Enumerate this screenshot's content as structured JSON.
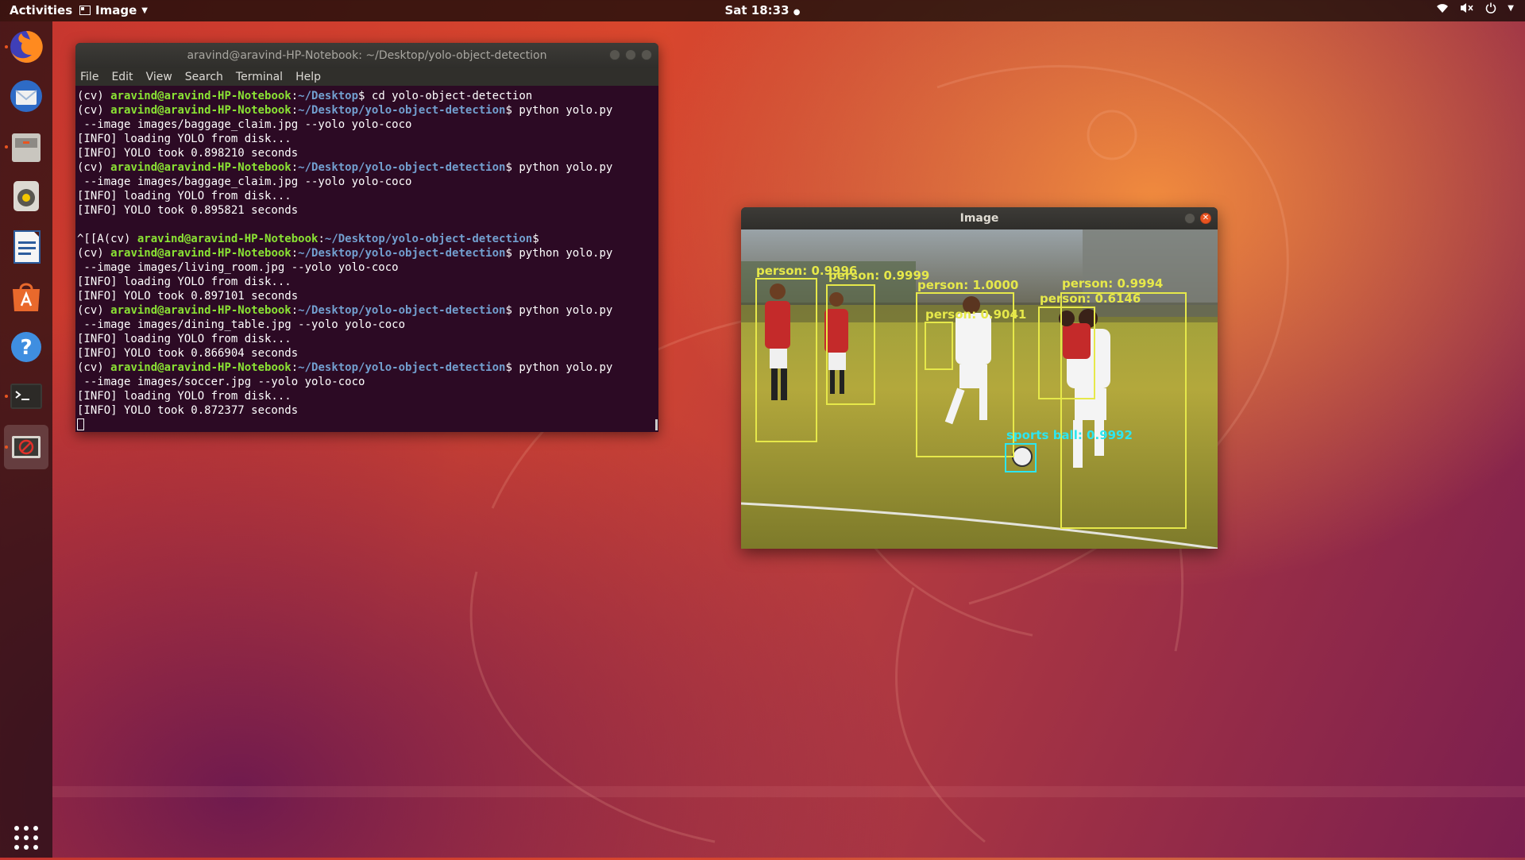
{
  "topbar": {
    "activities": "Activities",
    "app_name": "Image",
    "clock": "Sat 18:33"
  },
  "dock": {
    "items": [
      {
        "name": "firefox",
        "icon": "firefox-icon"
      },
      {
        "name": "thunderbird",
        "icon": "mail-icon"
      },
      {
        "name": "files",
        "icon": "files-icon"
      },
      {
        "name": "rhythmbox",
        "icon": "music-icon"
      },
      {
        "name": "libreoffice-writer",
        "icon": "writer-icon"
      },
      {
        "name": "ubuntu-software",
        "icon": "software-icon"
      },
      {
        "name": "help",
        "icon": "help-icon"
      },
      {
        "name": "terminal",
        "icon": "terminal-icon"
      },
      {
        "name": "image-viewer",
        "icon": "image-icon"
      }
    ],
    "show_apps_icon": "grid-icon"
  },
  "terminal": {
    "title": "aravind@aravind-HP-Notebook: ~/Desktop/yolo-object-detection",
    "menu": [
      "File",
      "Edit",
      "View",
      "Search",
      "Terminal",
      "Help"
    ],
    "env": "(cv) ",
    "user": "aravind@aravind-HP-Notebook",
    "lines": [
      {
        "prompt": true,
        "path": "~/Desktop",
        "cmd": "$ cd yolo-object-detection"
      },
      {
        "prompt": true,
        "path": "~/Desktop/yolo-object-detection",
        "cmd": "$ python yolo.py"
      },
      {
        "text": " --image images/baggage_claim.jpg --yolo yolo-coco"
      },
      {
        "text": "[INFO] loading YOLO from disk..."
      },
      {
        "text": "[INFO] YOLO took 0.898210 seconds"
      },
      {
        "prompt": true,
        "path": "~/Desktop/yolo-object-detection",
        "cmd": "$ python yolo.py"
      },
      {
        "text": " --image images/baggage_claim.jpg --yolo yolo-coco"
      },
      {
        "text": "[INFO] loading YOLO from disk..."
      },
      {
        "text": "[INFO] YOLO took 0.895821 seconds"
      },
      {
        "text": ""
      },
      {
        "prompt": true,
        "prefix": "^[[A",
        "path": "~/Desktop/yolo-object-detection",
        "cmd": "$"
      },
      {
        "prompt": true,
        "path": "~/Desktop/yolo-object-detection",
        "cmd": "$ python yolo.py"
      },
      {
        "text": " --image images/living_room.jpg --yolo yolo-coco"
      },
      {
        "text": "[INFO] loading YOLO from disk..."
      },
      {
        "text": "[INFO] YOLO took 0.897101 seconds"
      },
      {
        "prompt": true,
        "path": "~/Desktop/yolo-object-detection",
        "cmd": "$ python yolo.py"
      },
      {
        "text": " --image images/dining_table.jpg --yolo yolo-coco"
      },
      {
        "text": "[INFO] loading YOLO from disk..."
      },
      {
        "text": "[INFO] YOLO took 0.866904 seconds"
      },
      {
        "prompt": true,
        "path": "~/Desktop/yolo-object-detection",
        "cmd": "$ python yolo.py"
      },
      {
        "text": " --image images/soccer.jpg --yolo yolo-coco"
      },
      {
        "text": "[INFO] loading YOLO from disk..."
      },
      {
        "text": "[INFO] YOLO took 0.872377 seconds"
      }
    ]
  },
  "image_window": {
    "title": "Image",
    "detections": [
      {
        "label": "person: 0.9996",
        "color": "#e6e84a"
      },
      {
        "label": "person: 0.9999",
        "color": "#e6e84a"
      },
      {
        "label": "person: 1.0000",
        "color": "#e6e84a"
      },
      {
        "label": "person: 0.9041",
        "color": "#e6e84a"
      },
      {
        "label": "person: 0.9994",
        "color": "#e6e84a"
      },
      {
        "label": "person: 0.6146",
        "color": "#e6e84a"
      },
      {
        "label": "sports ball: 0.9992",
        "color": "#2de6f0"
      }
    ]
  },
  "colors": {
    "accent": "#e95420",
    "terminal_bg": "#2c0a24",
    "prompt_user": "#8ae234",
    "prompt_path": "#729fcf"
  }
}
